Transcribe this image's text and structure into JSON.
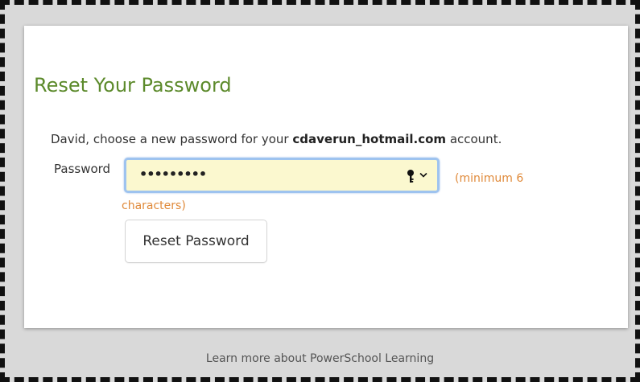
{
  "page": {
    "title": "Reset Your Password",
    "intro_prefix": "David, choose a new password for your ",
    "account_name": "cdaverun_hotmail.com",
    "intro_suffix": " account."
  },
  "form": {
    "password_label": "Password",
    "password_value_masked": "•••••••••",
    "hint_line1": "(minimum 6",
    "hint_line2": "characters)",
    "submit_label": "Reset Password"
  },
  "footer": {
    "link_text": "Learn more about PowerSchool Learning"
  },
  "icons": {
    "password_manager": "key-icon",
    "dropdown": "chevron-down-icon"
  },
  "colors": {
    "title": "#5c8a2b",
    "hint": "#e08a3a",
    "input_bg": "#fbf8cf",
    "input_focus_border": "#9ec3ef",
    "page_bg": "#d9d9d9"
  }
}
